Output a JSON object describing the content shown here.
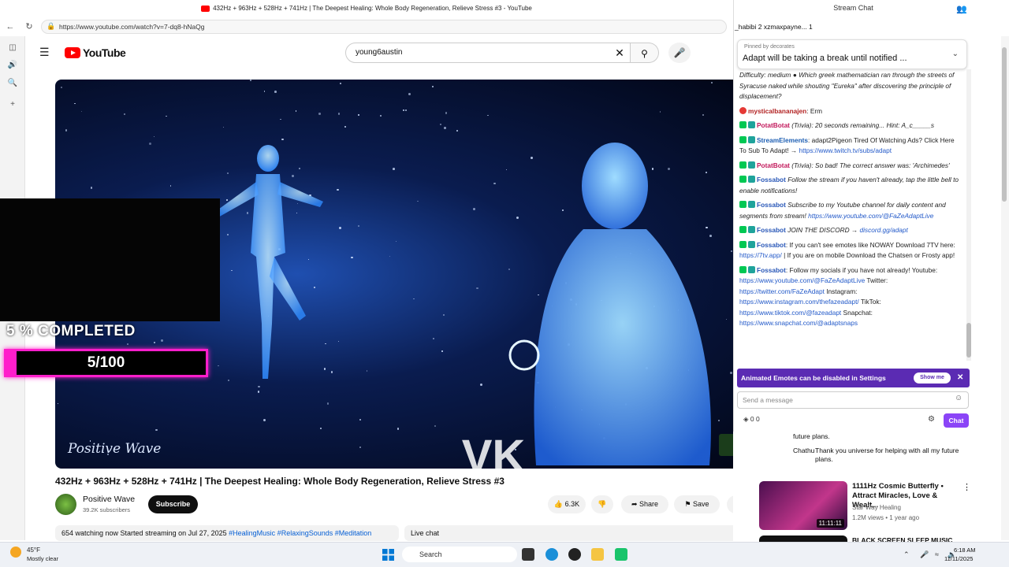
{
  "browser": {
    "tab_title": "432Hz + 963Hz + 528Hz + 741Hz | The Deepest Healing: Whole Body Regeneration, Relieve Stress #3 - YouTube",
    "url": "https://www.youtube.com/watch?v=7-dq8-hNaQg"
  },
  "youtube": {
    "logo_text": "YouTube",
    "search_value": "young6austin"
  },
  "video": {
    "overlay_progress_label": "5 % COMPLETED",
    "overlay_progress_count": "5/100",
    "overlay_progress_value": 0.05,
    "watermark": "Positive Wave",
    "vk_logo": "VK",
    "title": "432Hz + 963Hz + 528Hz + 741Hz | The Deepest Healing: Whole Body Regeneration, Relieve Stress #3",
    "channel_name": "Positive Wave",
    "channel_subs": "39.2K subscribers",
    "subscribe_label": "Subscribe",
    "likes": "6.3K",
    "share_label": "Share",
    "save_label": "Save",
    "description_stats": "654 watching now  Started streaming on Jul 27, 2025",
    "description_tags": "#HealingMusic #RelaxingSounds #Meditation",
    "live_chat_label": "Live chat"
  },
  "chat": {
    "window_title": "Stream Chat",
    "topbar_text": "_habibi  2  xzmaxpayne...  1",
    "pinned_by": "Pinned by  decorates",
    "pinned_text": "Adapt will be taking a break until notified ...",
    "messages": [
      {
        "text": "Difficulty: medium ● Which greek mathematician ran through the streets of Syracuse naked while shouting \"Eureka\" after discovering the principle of displacement?"
      },
      {
        "user": "mysticalbananajen",
        "text": " Erm"
      },
      {
        "user": "PotatBotat",
        "text": " (Trivia): 20 seconds remaining... Hint: A_c_____s"
      },
      {
        "user": "StreamElements",
        "text": " adapt2Pigeon Tired Of Watching Ads? Click Here To Sub To Adapt! → ",
        "link": "https://www.twitch.tv/subs/adapt"
      },
      {
        "user": "PotatBotat",
        "text": " (Trivia): So bad! The correct answer was: 'Archimedes'"
      },
      {
        "user": "Fossabot",
        "text": " Follow the stream if you haven't already, tap the little bell to enable notifications!"
      },
      {
        "user": "Fossabot",
        "text": " Subscribe to my Youtube channel for daily content and segments from stream! ",
        "link": "https://www.youtube.com/@FaZeAdaptLive"
      },
      {
        "user": "Fossabot",
        "text": " JOIN THE DISCORD → ",
        "link": "discord.gg/adapt"
      },
      {
        "user": "Fossabot",
        "text": ": If you can't see emotes like NOWAY Download 7TV here: ",
        "link": "https://7tv.app/",
        "text2": " | If you are on mobile Download the Chatsen or Frosty app!"
      },
      {
        "user": "Fossabot",
        "text": ": Follow my socials if you have not already! Youtube: ",
        "link": "https://www.youtube.com/@FaZeAdaptLive",
        "text2": " Twitter: ",
        "link2": "https://twitter.com/FaZeAdapt",
        "text3": " Instagram: ",
        "link3": "https://www.instagram.com/thefazeadapt/",
        "text4": " TikTok: ",
        "link4": "https://www.tiktok.com/@fazeadapt",
        "text5": " Snapchat: ",
        "link5": "https://www.snapchat.com/@adaptsnaps"
      }
    ],
    "emote_banner": "Animated Emotes can be disabled in Settings",
    "show_me": "Show me",
    "input_placeholder": "Send a message",
    "points": "0   0",
    "chat_button": "Chat"
  },
  "live_chat_snippet": {
    "line1": "future plans.",
    "user": "Chathu",
    "line2": "Thank you universe for helping with all my future plans."
  },
  "recommendation": {
    "title": "1111Hz Cosmic Butterfly • Attract Miracles, Love & Wealt...",
    "channel": "Star Way Healing",
    "meta": "1.2M views • 1 year ago",
    "duration": "11:11:11",
    "next_title": "BLACK SCREEN SLEEP MUSIC"
  },
  "taskbar": {
    "weather_temp": "45°F",
    "weather_desc": "Mostly clear",
    "search_label": "Search",
    "time": "6:18 AM",
    "date": "11/11/2025"
  },
  "colors": {
    "youtube_red": "#ff0000",
    "twitch_purple": "#8b44f7",
    "overlay_pink": "#ff1ecb"
  }
}
